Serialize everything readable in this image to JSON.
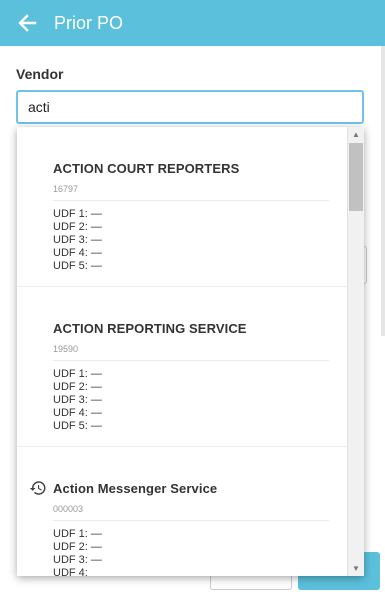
{
  "header": {
    "title": "Prior PO",
    "back_icon": "arrow-left-icon",
    "color": "#5bc0dc"
  },
  "form": {
    "vendor_label": "Vendor",
    "vendor_value": "acti"
  },
  "results": [
    {
      "name": "ACTION COURT REPORTERS",
      "code": "16797",
      "udf": [
        "UDF 1:  —",
        "UDF 2:  —",
        "UDF 3:  —",
        "UDF 4:  —",
        "UDF 5:  —"
      ],
      "recent": false
    },
    {
      "name": "ACTION REPORTING SERVICE",
      "code": "19590",
      "udf": [
        "UDF 1:  —",
        "UDF 2:  —",
        "UDF 3:  —",
        "UDF 4:  —",
        "UDF 5:  —"
      ],
      "recent": false
    },
    {
      "name": "Action Messenger Service",
      "code": "000003",
      "udf": [
        "UDF 1:  —",
        "UDF 2:  —",
        "UDF 3:  —",
        "UDF 4:"
      ],
      "recent": true,
      "icon": "history-icon"
    }
  ]
}
